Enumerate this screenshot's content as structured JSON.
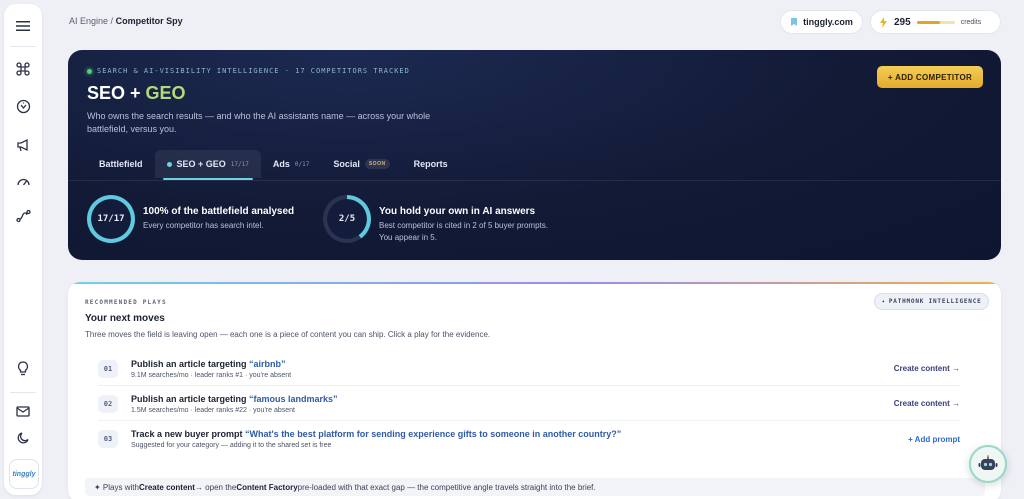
{
  "breadcrumb": {
    "parent": "AI Engine",
    "separator": "/",
    "current": "Competitor Spy"
  },
  "topbar": {
    "domain": "tinggly.com",
    "credits_value": "295",
    "credits_label": "credits",
    "credits_fill_fraction": 0.62
  },
  "sidebar": {
    "items": [
      {
        "icon": "menu-icon"
      },
      {
        "icon": "command-icon"
      },
      {
        "icon": "bug-icon"
      },
      {
        "icon": "megaphone-icon"
      },
      {
        "icon": "gauge-icon"
      },
      {
        "icon": "route-icon"
      },
      {
        "icon": "lightbulb-icon"
      },
      {
        "icon": "mail-icon"
      },
      {
        "icon": "moon-icon"
      }
    ],
    "logo_text": "tinggly"
  },
  "hero": {
    "kicker": "SEARCH & AI-VISIBILITY INTELLIGENCE · 17 COMPETITORS TRACKED",
    "title_main": "SEO + ",
    "title_accent": "GEO",
    "description": "Who owns the search results — and who the AI assistants name — across your whole battlefield, versus you.",
    "add_button": "+ ADD COMPETITOR",
    "tabs": [
      {
        "label": "Battlefield",
        "count": "",
        "badge": ""
      },
      {
        "label": "SEO + GEO",
        "count": "17/17",
        "badge": ""
      },
      {
        "label": "Ads",
        "count": "0/17",
        "badge": ""
      },
      {
        "label": "Social",
        "count": "",
        "badge": "SOON"
      },
      {
        "label": "Reports",
        "count": "",
        "badge": ""
      }
    ],
    "stats": [
      {
        "ring_text": "17/17",
        "fraction": 1.0,
        "title": "100% of the battlefield analysed",
        "sub": "Every competitor has search intel."
      },
      {
        "ring_text": "2/5",
        "fraction": 0.4,
        "title": "You hold your own in AI answers",
        "sub": "Best competitor is cited in 2 of 5 buyer prompts. You appear in 5."
      }
    ]
  },
  "plays": {
    "kicker": "RECOMMENDED PLAYS",
    "title": "Your next moves",
    "description": "Three moves the field is leaving open — each one is a piece of content you can ship. Click a play for the evidence.",
    "badge": "PATHMONK INTELLIGENCE",
    "items": [
      {
        "num": "01",
        "title_prefix": "Publish an article targeting ",
        "keyword": "“airbnb”",
        "meta": "9.1M searches/mo · leader ranks #1 · you're absent",
        "action": "Create content →"
      },
      {
        "num": "02",
        "title_prefix": "Publish an article targeting ",
        "keyword": "“famous landmarks”",
        "meta": "1.5M searches/mo · leader ranks #22 · you're absent",
        "action": "Create content →"
      },
      {
        "num": "03",
        "title_prefix": "Track a new buyer prompt ",
        "keyword": "“What's the best platform for sending experience gifts to someone in another country?”",
        "meta": "Suggested for your category — adding it to the shared set is free",
        "action": "+ Add prompt"
      }
    ],
    "footer": {
      "prefix": "✦ Plays with ",
      "b1": "Create content",
      "mid1": " → open the ",
      "b2": "Content Factory",
      "suffix": " pre-loaded with that exact gap — the competitive angle travels straight into the brief."
    }
  },
  "colors": {
    "hero_bg": "#121a36",
    "accent_gold": "#e3ac2c",
    "accent_cyan": "#6fd2e4",
    "geo_green": "#b4d97a"
  }
}
